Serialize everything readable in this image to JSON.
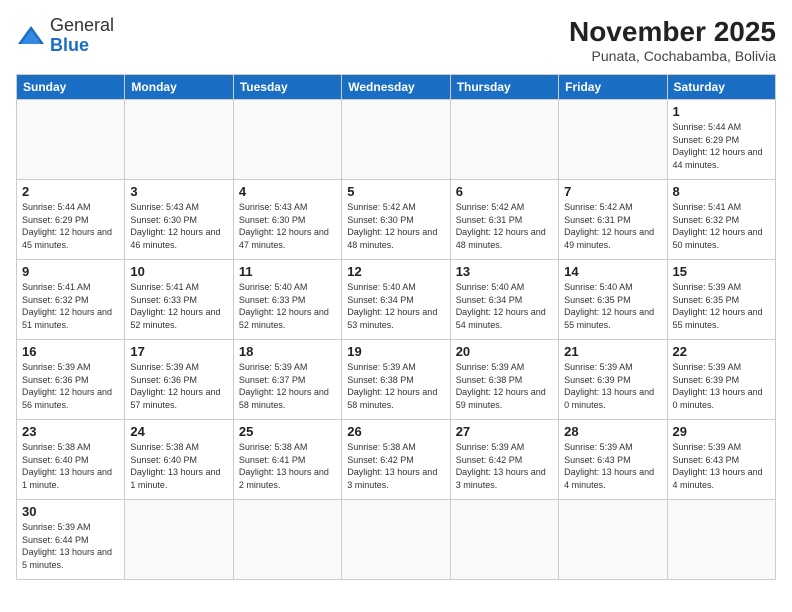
{
  "header": {
    "logo_general": "General",
    "logo_blue": "Blue",
    "month": "November 2025",
    "location": "Punata, Cochabamba, Bolivia"
  },
  "days_of_week": [
    "Sunday",
    "Monday",
    "Tuesday",
    "Wednesday",
    "Thursday",
    "Friday",
    "Saturday"
  ],
  "weeks": [
    [
      {
        "day": "",
        "info": ""
      },
      {
        "day": "",
        "info": ""
      },
      {
        "day": "",
        "info": ""
      },
      {
        "day": "",
        "info": ""
      },
      {
        "day": "",
        "info": ""
      },
      {
        "day": "",
        "info": ""
      },
      {
        "day": "1",
        "info": "Sunrise: 5:44 AM\nSunset: 6:29 PM\nDaylight: 12 hours and 44 minutes."
      }
    ],
    [
      {
        "day": "2",
        "info": "Sunrise: 5:44 AM\nSunset: 6:29 PM\nDaylight: 12 hours and 45 minutes."
      },
      {
        "day": "3",
        "info": "Sunrise: 5:43 AM\nSunset: 6:30 PM\nDaylight: 12 hours and 46 minutes."
      },
      {
        "day": "4",
        "info": "Sunrise: 5:43 AM\nSunset: 6:30 PM\nDaylight: 12 hours and 47 minutes."
      },
      {
        "day": "5",
        "info": "Sunrise: 5:42 AM\nSunset: 6:30 PM\nDaylight: 12 hours and 48 minutes."
      },
      {
        "day": "6",
        "info": "Sunrise: 5:42 AM\nSunset: 6:31 PM\nDaylight: 12 hours and 48 minutes."
      },
      {
        "day": "7",
        "info": "Sunrise: 5:42 AM\nSunset: 6:31 PM\nDaylight: 12 hours and 49 minutes."
      },
      {
        "day": "8",
        "info": "Sunrise: 5:41 AM\nSunset: 6:32 PM\nDaylight: 12 hours and 50 minutes."
      }
    ],
    [
      {
        "day": "9",
        "info": "Sunrise: 5:41 AM\nSunset: 6:32 PM\nDaylight: 12 hours and 51 minutes."
      },
      {
        "day": "10",
        "info": "Sunrise: 5:41 AM\nSunset: 6:33 PM\nDaylight: 12 hours and 52 minutes."
      },
      {
        "day": "11",
        "info": "Sunrise: 5:40 AM\nSunset: 6:33 PM\nDaylight: 12 hours and 52 minutes."
      },
      {
        "day": "12",
        "info": "Sunrise: 5:40 AM\nSunset: 6:34 PM\nDaylight: 12 hours and 53 minutes."
      },
      {
        "day": "13",
        "info": "Sunrise: 5:40 AM\nSunset: 6:34 PM\nDaylight: 12 hours and 54 minutes."
      },
      {
        "day": "14",
        "info": "Sunrise: 5:40 AM\nSunset: 6:35 PM\nDaylight: 12 hours and 55 minutes."
      },
      {
        "day": "15",
        "info": "Sunrise: 5:39 AM\nSunset: 6:35 PM\nDaylight: 12 hours and 55 minutes."
      }
    ],
    [
      {
        "day": "16",
        "info": "Sunrise: 5:39 AM\nSunset: 6:36 PM\nDaylight: 12 hours and 56 minutes."
      },
      {
        "day": "17",
        "info": "Sunrise: 5:39 AM\nSunset: 6:36 PM\nDaylight: 12 hours and 57 minutes."
      },
      {
        "day": "18",
        "info": "Sunrise: 5:39 AM\nSunset: 6:37 PM\nDaylight: 12 hours and 58 minutes."
      },
      {
        "day": "19",
        "info": "Sunrise: 5:39 AM\nSunset: 6:38 PM\nDaylight: 12 hours and 58 minutes."
      },
      {
        "day": "20",
        "info": "Sunrise: 5:39 AM\nSunset: 6:38 PM\nDaylight: 12 hours and 59 minutes."
      },
      {
        "day": "21",
        "info": "Sunrise: 5:39 AM\nSunset: 6:39 PM\nDaylight: 13 hours and 0 minutes."
      },
      {
        "day": "22",
        "info": "Sunrise: 5:39 AM\nSunset: 6:39 PM\nDaylight: 13 hours and 0 minutes."
      }
    ],
    [
      {
        "day": "23",
        "info": "Sunrise: 5:38 AM\nSunset: 6:40 PM\nDaylight: 13 hours and 1 minute."
      },
      {
        "day": "24",
        "info": "Sunrise: 5:38 AM\nSunset: 6:40 PM\nDaylight: 13 hours and 1 minute."
      },
      {
        "day": "25",
        "info": "Sunrise: 5:38 AM\nSunset: 6:41 PM\nDaylight: 13 hours and 2 minutes."
      },
      {
        "day": "26",
        "info": "Sunrise: 5:38 AM\nSunset: 6:42 PM\nDaylight: 13 hours and 3 minutes."
      },
      {
        "day": "27",
        "info": "Sunrise: 5:39 AM\nSunset: 6:42 PM\nDaylight: 13 hours and 3 minutes."
      },
      {
        "day": "28",
        "info": "Sunrise: 5:39 AM\nSunset: 6:43 PM\nDaylight: 13 hours and 4 minutes."
      },
      {
        "day": "29",
        "info": "Sunrise: 5:39 AM\nSunset: 6:43 PM\nDaylight: 13 hours and 4 minutes."
      }
    ],
    [
      {
        "day": "30",
        "info": "Sunrise: 5:39 AM\nSunset: 6:44 PM\nDaylight: 13 hours and 5 minutes."
      },
      {
        "day": "",
        "info": ""
      },
      {
        "day": "",
        "info": ""
      },
      {
        "day": "",
        "info": ""
      },
      {
        "day": "",
        "info": ""
      },
      {
        "day": "",
        "info": ""
      },
      {
        "day": "",
        "info": ""
      }
    ]
  ]
}
